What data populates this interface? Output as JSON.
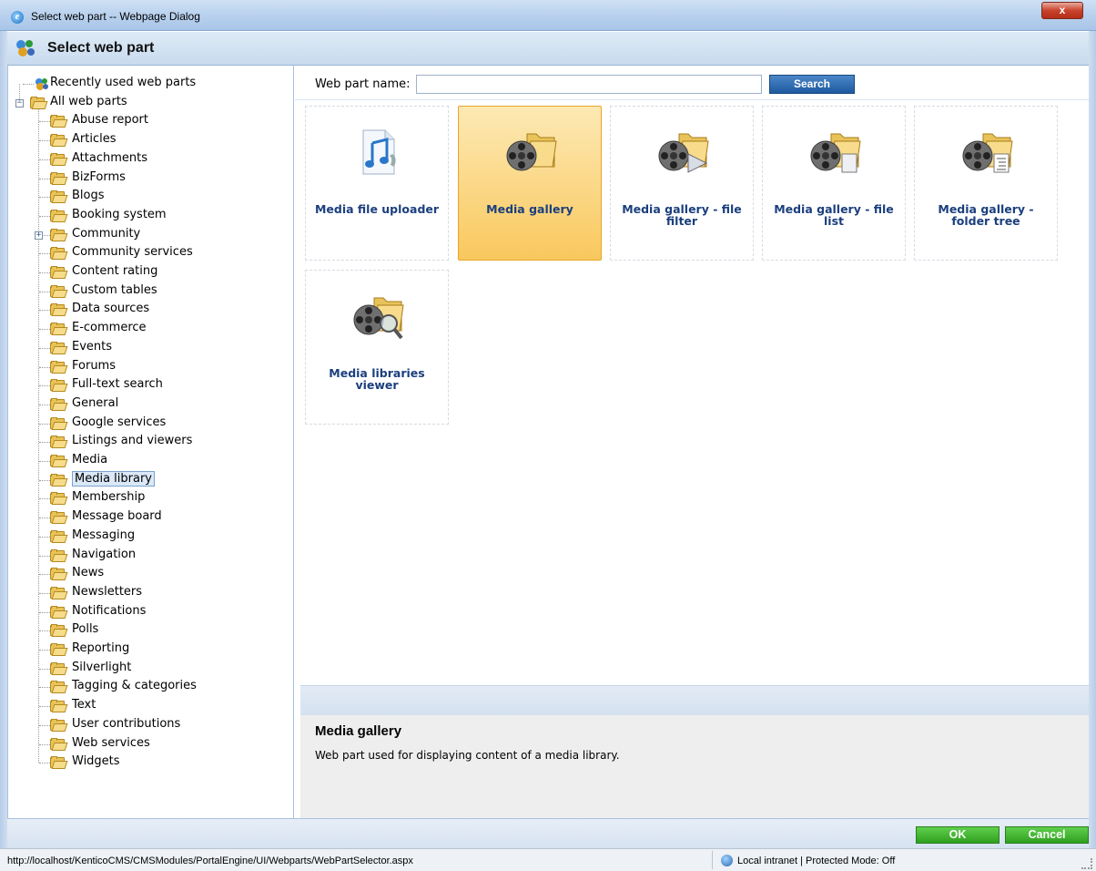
{
  "window": {
    "title": "Select web part -- Webpage Dialog",
    "close_label": "x"
  },
  "header": {
    "title": "Select web part"
  },
  "tree": {
    "recent": "Recently used web parts",
    "root": "All web parts",
    "items": [
      "Abuse report",
      "Articles",
      "Attachments",
      "BizForms",
      "Blogs",
      "Booking system",
      "Community",
      "Community services",
      "Content rating",
      "Custom tables",
      "Data sources",
      "E-commerce",
      "Events",
      "Forums",
      "Full-text search",
      "General",
      "Google services",
      "Listings and viewers",
      "Media",
      "Media library",
      "Membership",
      "Message board",
      "Messaging",
      "Navigation",
      "News",
      "Newsletters",
      "Notifications",
      "Polls",
      "Reporting",
      "Silverlight",
      "Tagging & categories",
      "Text",
      "User contributions",
      "Web services",
      "Widgets"
    ],
    "selected": "Media library",
    "expandable": "Community"
  },
  "search": {
    "label": "Web part name:",
    "value": "",
    "button": "Search"
  },
  "webparts": [
    {
      "name": "Media file uploader",
      "icon": "audio-file-icon",
      "selected": false
    },
    {
      "name": "Media gallery",
      "icon": "media-folder-icon",
      "selected": true
    },
    {
      "name": "Media gallery - file filter",
      "icon": "media-filter-icon",
      "selected": false
    },
    {
      "name": "Media gallery - file list",
      "icon": "media-list-icon",
      "selected": false
    },
    {
      "name": "Media gallery - folder tree",
      "icon": "media-tree-icon",
      "selected": false
    },
    {
      "name": "Media libraries viewer",
      "icon": "media-viewer-icon",
      "selected": false
    }
  ],
  "description": {
    "title": "Media gallery",
    "text": "Web part used for displaying content of a media library."
  },
  "buttons": {
    "ok": "OK",
    "cancel": "Cancel"
  },
  "status": {
    "url": "http://localhost/KenticoCMS/CMSModules/PortalEngine/UI/Webparts/WebPartSelector.aspx",
    "zone": "Local intranet | Protected Mode: Off"
  }
}
